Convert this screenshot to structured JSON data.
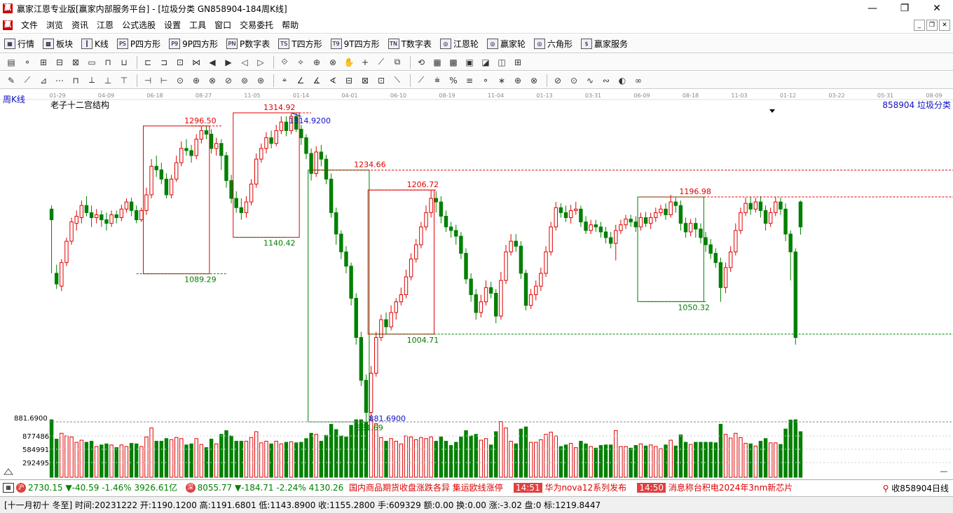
{
  "window": {
    "title": "赢家江恩专业版[赢家内部服务平台] - [垃圾分类  GN858904-184周K线]",
    "logo_char": "赢",
    "minimize": "—",
    "maximize": "❐",
    "close": "✕"
  },
  "menu": [
    "文件",
    "浏览",
    "资讯",
    "江恩",
    "公式选股",
    "设置",
    "工具",
    "窗口",
    "交易委托",
    "帮助"
  ],
  "nav": [
    {
      "icon": "▦",
      "label": "行情"
    },
    {
      "icon": "▩",
      "label": "板块"
    },
    {
      "icon": "┃",
      "label": "K线"
    },
    {
      "icon": "PS",
      "label": "P四方形"
    },
    {
      "icon": "P9",
      "label": "9P四方形"
    },
    {
      "icon": "PN",
      "label": "P数字表"
    },
    {
      "icon": "TS",
      "label": "T四方形"
    },
    {
      "icon": "T9",
      "label": "9T四方形"
    },
    {
      "icon": "TN",
      "label": "T数字表"
    },
    {
      "icon": "◎",
      "label": "江恩轮"
    },
    {
      "icon": "◎",
      "label": "赢家轮"
    },
    {
      "icon": "◎",
      "label": "六角形"
    },
    {
      "icon": "$",
      "label": "赢家服务"
    }
  ],
  "chart": {
    "period_label": "周K线",
    "structure_label": "老子十二宫结构",
    "code_label": "858904  垃圾分类",
    "date_ticks": [
      "01-29",
      "04-09",
      "06-18",
      "08-27",
      "11-05",
      "01-14",
      "04-01",
      "06-10",
      "08-19",
      "11-04",
      "01-13",
      "03-31",
      "06-09",
      "08-18",
      "11-03",
      "01-12",
      "03-22",
      "05-31",
      "08-09"
    ],
    "price_annotations": {
      "high1": "1296.50",
      "low1": "1089.29",
      "high2": "1314.92",
      "high2_marker": "1314.9200",
      "low2": "1140.42",
      "high3": "1234.66",
      "low3": "881.69",
      "low3_marker": "881.6900",
      "high4": "1206.72",
      "low4": "1004.71",
      "high5": "1196.98",
      "low5": "1050.32"
    },
    "y_axis_low": "881.6900",
    "volume_axis": [
      "877486",
      "584991",
      "292495"
    ],
    "colors": {
      "up": "#e00000",
      "down": "#008000",
      "annot_blue": "#1010c0",
      "box_red": "#e00000",
      "box_green": "#008000"
    }
  },
  "chart_data": {
    "type": "candlestick",
    "title": "垃圾分类 GN858904-184周K线",
    "series": [
      {
        "name": "垃圾分类",
        "ohlc": [
          [
            1180,
            1165,
            1185,
            1090
          ],
          [
            1090,
            1075,
            1102,
            1068
          ],
          [
            1072,
            1105,
            1110,
            1065
          ],
          [
            1105,
            1135,
            1140,
            1100
          ],
          [
            1135,
            1162,
            1168,
            1130
          ],
          [
            1160,
            1170,
            1178,
            1150
          ],
          [
            1168,
            1185,
            1192,
            1160
          ],
          [
            1185,
            1175,
            1198,
            1170
          ],
          [
            1175,
            1168,
            1185,
            1155
          ],
          [
            1168,
            1172,
            1180,
            1160
          ],
          [
            1172,
            1165,
            1178,
            1155
          ],
          [
            1165,
            1160,
            1175,
            1150
          ],
          [
            1160,
            1172,
            1178,
            1155
          ],
          [
            1172,
            1168,
            1178,
            1160
          ],
          [
            1168,
            1180,
            1186,
            1163
          ],
          [
            1180,
            1190,
            1195,
            1175
          ],
          [
            1190,
            1178,
            1196,
            1170
          ],
          [
            1178,
            1165,
            1185,
            1160
          ],
          [
            1165,
            1178,
            1182,
            1162
          ],
          [
            1178,
            1200,
            1210,
            1172
          ],
          [
            1200,
            1240,
            1250,
            1195
          ],
          [
            1240,
            1235,
            1255,
            1225
          ],
          [
            1235,
            1222,
            1245,
            1215
          ],
          [
            1222,
            1200,
            1230,
            1195
          ],
          [
            1200,
            1222,
            1228,
            1195
          ],
          [
            1222,
            1245,
            1255,
            1218
          ],
          [
            1245,
            1265,
            1275,
            1240
          ],
          [
            1265,
            1262,
            1278,
            1255
          ],
          [
            1262,
            1255,
            1270,
            1245
          ],
          [
            1255,
            1278,
            1285,
            1250
          ],
          [
            1278,
            1290,
            1296,
            1272
          ],
          [
            1290,
            1285,
            1296,
            1278
          ],
          [
            1285,
            1265,
            1292,
            1258
          ],
          [
            1265,
            1272,
            1280,
            1255
          ],
          [
            1272,
            1255,
            1278,
            1235
          ],
          [
            1255,
            1220,
            1260,
            1210
          ],
          [
            1220,
            1195,
            1228,
            1188
          ],
          [
            1195,
            1182,
            1205,
            1175
          ],
          [
            1182,
            1175,
            1195,
            1165
          ],
          [
            1175,
            1190,
            1198,
            1168
          ],
          [
            1190,
            1215,
            1222,
            1185
          ],
          [
            1215,
            1250,
            1258,
            1210
          ],
          [
            1250,
            1265,
            1272,
            1245
          ],
          [
            1265,
            1280,
            1288,
            1258
          ],
          [
            1280,
            1272,
            1290,
            1265
          ],
          [
            1272,
            1290,
            1298,
            1268
          ],
          [
            1290,
            1302,
            1310,
            1285
          ],
          [
            1302,
            1290,
            1310,
            1282
          ],
          [
            1290,
            1310,
            1314,
            1285
          ],
          [
            1310,
            1292,
            1315,
            1288
          ],
          [
            1292,
            1280,
            1298,
            1270
          ],
          [
            1280,
            1258,
            1285,
            1250
          ],
          [
            1258,
            1230,
            1265,
            1220
          ],
          [
            1230,
            1260,
            1268,
            1225
          ],
          [
            1260,
            1250,
            1270,
            1240
          ],
          [
            1250,
            1222,
            1256,
            1215
          ],
          [
            1222,
            1175,
            1230,
            1168
          ],
          [
            1175,
            1145,
            1182,
            1130
          ],
          [
            1145,
            1120,
            1150,
            1110
          ],
          [
            1120,
            1100,
            1128,
            1090
          ],
          [
            1100,
            1055,
            1105,
            1045
          ],
          [
            1055,
            1000,
            1062,
            990
          ],
          [
            1000,
            940,
            1008,
            932
          ],
          [
            940,
            895,
            948,
            882
          ],
          [
            895,
            950,
            960,
            885
          ],
          [
            950,
            1000,
            1008,
            945
          ],
          [
            1000,
            1025,
            1032,
            995
          ],
          [
            1025,
            1015,
            1035,
            1005
          ],
          [
            1015,
            1035,
            1045,
            1010
          ],
          [
            1035,
            1050,
            1055,
            1025
          ],
          [
            1050,
            1060,
            1070,
            1045
          ],
          [
            1060,
            1085,
            1095,
            1055
          ],
          [
            1085,
            1110,
            1118,
            1080
          ],
          [
            1110,
            1130,
            1138,
            1105
          ],
          [
            1130,
            1155,
            1162,
            1125
          ],
          [
            1155,
            1175,
            1185,
            1150
          ],
          [
            1175,
            1195,
            1206,
            1168
          ],
          [
            1195,
            1190,
            1205,
            1175
          ],
          [
            1190,
            1170,
            1198,
            1160
          ],
          [
            1170,
            1155,
            1178,
            1148
          ],
          [
            1155,
            1150,
            1162,
            1140
          ],
          [
            1150,
            1142,
            1158,
            1130
          ],
          [
            1142,
            1118,
            1148,
            1110
          ],
          [
            1118,
            1082,
            1125,
            1075
          ],
          [
            1082,
            1060,
            1090,
            1050
          ],
          [
            1060,
            1035,
            1068,
            1025
          ],
          [
            1035,
            1050,
            1060,
            1028
          ],
          [
            1050,
            1070,
            1080,
            1045
          ],
          [
            1070,
            1062,
            1078,
            1055
          ],
          [
            1062,
            1030,
            1068,
            1020
          ],
          [
            1030,
            1080,
            1092,
            1025
          ],
          [
            1080,
            1120,
            1130,
            1075
          ],
          [
            1120,
            1135,
            1145,
            1115
          ],
          [
            1135,
            1128,
            1145,
            1120
          ],
          [
            1128,
            1090,
            1135,
            1082
          ],
          [
            1090,
            1045,
            1095,
            1038
          ],
          [
            1045,
            1060,
            1068,
            1040
          ],
          [
            1060,
            1072,
            1080,
            1052
          ],
          [
            1072,
            1090,
            1098,
            1065
          ],
          [
            1090,
            1120,
            1128,
            1085
          ],
          [
            1120,
            1155,
            1162,
            1115
          ],
          [
            1155,
            1182,
            1190,
            1150
          ],
          [
            1182,
            1175,
            1188,
            1168
          ],
          [
            1175,
            1168,
            1185,
            1162
          ],
          [
            1168,
            1178,
            1186,
            1160
          ],
          [
            1178,
            1180,
            1190,
            1172
          ],
          [
            1180,
            1162,
            1185,
            1155
          ],
          [
            1162,
            1150,
            1170,
            1145
          ],
          [
            1150,
            1158,
            1165,
            1145
          ],
          [
            1158,
            1155,
            1165,
            1148
          ],
          [
            1155,
            1148,
            1162,
            1140
          ],
          [
            1148,
            1140,
            1155,
            1132
          ],
          [
            1140,
            1132,
            1148,
            1125
          ],
          [
            1132,
            1150,
            1158,
            1108
          ],
          [
            1150,
            1158,
            1165,
            1145
          ],
          [
            1158,
            1166,
            1172,
            1152
          ],
          [
            1166,
            1162,
            1172,
            1155
          ],
          [
            1162,
            1155,
            1170,
            1148
          ],
          [
            1155,
            1168,
            1175,
            1150
          ],
          [
            1168,
            1160,
            1176,
            1155
          ],
          [
            1160,
            1168,
            1175,
            1152
          ],
          [
            1168,
            1175,
            1182,
            1162
          ],
          [
            1175,
            1180,
            1186,
            1170
          ],
          [
            1180,
            1172,
            1188,
            1165
          ],
          [
            1172,
            1190,
            1200,
            1168
          ],
          [
            1190,
            1185,
            1196,
            1175
          ],
          [
            1185,
            1160,
            1192,
            1150
          ],
          [
            1160,
            1148,
            1168,
            1140
          ],
          [
            1148,
            1160,
            1166,
            1142
          ],
          [
            1160,
            1152,
            1168,
            1140
          ],
          [
            1152,
            1140,
            1160,
            1132
          ],
          [
            1140,
            1130,
            1148,
            1120
          ],
          [
            1130,
            1118,
            1138,
            1110
          ],
          [
            1118,
            1105,
            1125,
            1098
          ],
          [
            1105,
            1070,
            1112,
            1050
          ],
          [
            1070,
            1098,
            1105,
            1062
          ],
          [
            1098,
            1120,
            1128,
            1092
          ],
          [
            1120,
            1150,
            1160,
            1115
          ],
          [
            1150,
            1175,
            1182,
            1145
          ],
          [
            1175,
            1188,
            1196,
            1170
          ],
          [
            1188,
            1180,
            1197,
            1172
          ],
          [
            1180,
            1190,
            1196,
            1175
          ],
          [
            1190,
            1178,
            1198,
            1168
          ],
          [
            1178,
            1160,
            1185,
            1150
          ],
          [
            1160,
            1175,
            1182,
            1155
          ],
          [
            1175,
            1190,
            1197,
            1170
          ],
          [
            1190,
            1180,
            1196,
            1172
          ],
          [
            1180,
            1145,
            1188,
            1135
          ],
          [
            1145,
            1120,
            1150,
            1080
          ],
          [
            1120,
            1000,
            1125,
            990
          ],
          [
            1190,
            1155,
            1192,
            1144
          ]
        ]
      }
    ],
    "ylim": [
      881.69,
      1314.92
    ],
    "annotations": [
      "1296.50",
      "1089.29",
      "1314.92",
      "1140.42",
      "1234.66",
      "881.69",
      "1206.72",
      "1004.71",
      "1196.98",
      "1050.32"
    ]
  },
  "status": {
    "index1_value": "2730.15",
    "index1_change": "▼-40.59",
    "index1_pct": "-1.46%",
    "index1_amount": "3926.61亿",
    "index2_value": "8055.77",
    "index2_change": "▼-184.71",
    "index2_pct": "-2.24%",
    "index2_amount": "4130.26",
    "news1": "国内商品期货收盘涨跌各异 集运欧线涨停",
    "news2_time": "14:51",
    "news2": "华为nova12系列发布",
    "news3_time": "14:50",
    "news3": "消息称台积电2024年3nm新芯片",
    "right_label": "收858904日线"
  },
  "info": {
    "text": "[十一月初十 冬至] 时间:20231222 开:1190.1200 高:1191.6801 低:1143.8900 收:1155.2800 手:609329 额:0.00 换:0.00 涨:-3.02 盘:0 标:1219.8447"
  }
}
